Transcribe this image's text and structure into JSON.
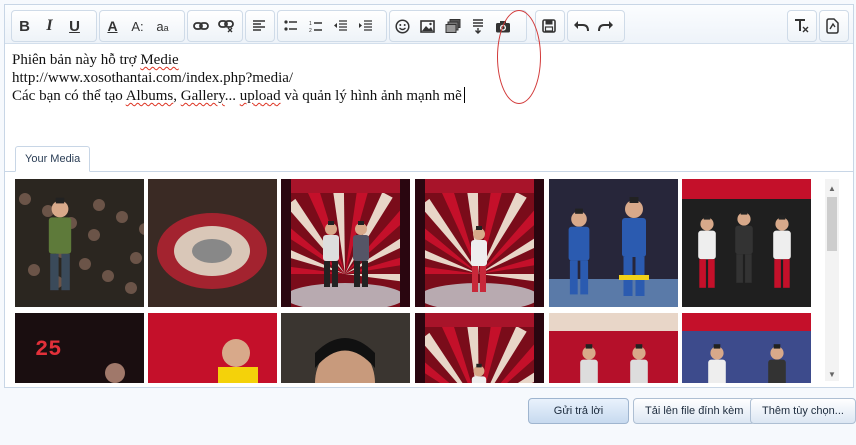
{
  "toolbar": {
    "buttons": [
      {
        "name": "bold-button",
        "label": "B"
      },
      {
        "name": "italic-button",
        "label": "I"
      },
      {
        "name": "underline-button",
        "label": "U"
      },
      {
        "name": "text-color-button",
        "label": "A"
      },
      {
        "name": "font-size-button",
        "label": "A:"
      },
      {
        "name": "font-family-button",
        "label": "a"
      }
    ],
    "icons": [
      "bold-icon",
      "italic-icon",
      "underline-icon",
      "text-color-icon",
      "font-size-icon",
      "font-family-icon",
      "link-icon",
      "unlink-icon",
      "align-left-icon",
      "bulleted-list-icon",
      "numbered-list-icon",
      "outdent-icon",
      "indent-icon",
      "smilies-icon",
      "image-icon",
      "media-icon",
      "insert-more-icon",
      "camera-icon",
      "save-draft-icon",
      "undo-icon",
      "redo-icon",
      "remove-formatting-icon",
      "toggle-bbcode-icon"
    ]
  },
  "editor": {
    "lines": [
      {
        "pre": "Phiên bản này hỗ trợ ",
        "underlined": "Medie",
        "post": ""
      },
      {
        "pre": "http://www.xosothantai.com/index.php?media/",
        "underlined": "",
        "post": ""
      },
      {
        "pre": "Các bạn có thể tạo ",
        "underlined": "Albums",
        "mid": ", ",
        "underlined2": "Gallery",
        "mid2": "... ",
        "underlined3": "upload",
        "post": " và quản lý hình ảnh mạnh mẽ"
      }
    ]
  },
  "media_tab": {
    "label": "Your Media"
  },
  "gallery": {
    "thumbnails": [
      {
        "scene": "performer-crowd"
      },
      {
        "scene": "stage-overhead"
      },
      {
        "scene": "red-stage-duo"
      },
      {
        "scene": "red-stage-girl"
      },
      {
        "scene": "martial-arts"
      },
      {
        "scene": "trio-costumes"
      },
      {
        "scene": "dark-stage-timer",
        "timer": "25"
      },
      {
        "scene": "red-stage-closeup"
      },
      {
        "scene": "face-closeup"
      },
      {
        "scene": "red-stage-far"
      },
      {
        "scene": "red-stage-comic"
      },
      {
        "scene": "blue-stage-comic"
      }
    ]
  },
  "actions": {
    "submit_label": "Gửi trả lời",
    "upload_label": "Tải lên file đính kèm",
    "more_options_label": "Thêm tùy chọn..."
  },
  "colors": {
    "annotation_ring": "#d23a3a",
    "stage_red": "#c4102a",
    "border": "#c8d6e6"
  }
}
